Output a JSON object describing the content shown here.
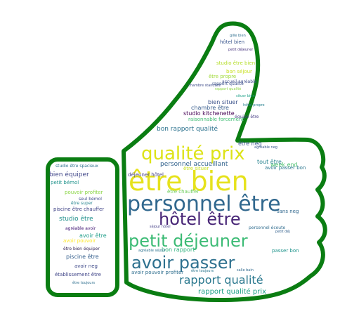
{
  "wordcloud": {
    "outline_color": "#0a7d12",
    "words": [
      {
        "id": "w-etre-bien",
        "text": "être bien",
        "color": "#e6e21c"
      },
      {
        "id": "w-personnel-etre",
        "text": "personnel être",
        "color": "#31688e"
      },
      {
        "id": "w-qualite-prix",
        "text": "qualité prix",
        "color": "#dde318"
      },
      {
        "id": "w-hotel-etre",
        "text": "hôtel être",
        "color": "#482677"
      },
      {
        "id": "w-petit-dejeuner",
        "text": "petit déjeuner",
        "color": "#3cbb75"
      },
      {
        "id": "w-avoir-passer",
        "text": "avoir passer",
        "color": "#2d708e"
      },
      {
        "id": "w-rapport-qualite",
        "text": "rapport qualité",
        "color": "#2a788e"
      },
      {
        "id": "w-rapport-qualite-prix",
        "text": "rapport qualité prix",
        "color": "#1fa187"
      },
      {
        "id": "w-personnel-accueillant",
        "text": "personnel accueillant",
        "color": "#33638d"
      },
      {
        "id": "w-bon-rapport-qualite",
        "text": "bon rapport qualité",
        "color": "#2c728e"
      },
      {
        "id": "w-studio-kitchenette",
        "text": "studio kitchenette",
        "color": "#440154"
      },
      {
        "id": "w-chambre-etre",
        "text": "chambre être",
        "color": "#365c8d"
      },
      {
        "id": "w-bien-situer",
        "text": "bien situer",
        "color": "#3b528b"
      },
      {
        "id": "w-hotel-bien",
        "text": "hôtel bien",
        "color": "#39558c"
      },
      {
        "id": "w-studio-etre-bien",
        "text": "studio être bien",
        "color": "#b5de2b"
      },
      {
        "id": "w-etre-propre",
        "text": "être propre",
        "color": "#a0da39"
      },
      {
        "id": "w-bon-sejour",
        "text": "bon séjour",
        "color": "#c8e020"
      },
      {
        "id": "w-raisonnable-forcement",
        "text": "raisonnable forcement",
        "color": "#3fbc73"
      },
      {
        "id": "w-week-end",
        "text": "week end",
        "color": "#4ac16d"
      },
      {
        "id": "w-tout-etre",
        "text": "tout être",
        "color": "#26828e"
      },
      {
        "id": "w-avoir-passer-bon",
        "text": "avoir passer bon",
        "color": "#2a768e"
      },
      {
        "id": "w-etre-neg",
        "text": "être neg",
        "color": "#3a548c"
      },
      {
        "id": "w-sans-neg",
        "text": "sans neg",
        "color": "#31688e"
      },
      {
        "id": "w-personnel-ecoute",
        "text": "personnel écoute",
        "color": "#2f6c8e"
      },
      {
        "id": "w-passer-bon",
        "text": "passer bon",
        "color": "#1f948c"
      },
      {
        "id": "w-bon-rapport",
        "text": "bon rapport",
        "color": "#2db27d"
      },
      {
        "id": "w-avoir-pouvoir-profiter",
        "text": "avoir pouvoir profiter",
        "color": "#2e6e8e"
      },
      {
        "id": "w-etre-chauffer",
        "text": "être chauffer",
        "color": "#6ccd5a"
      },
      {
        "id": "w-dejeuner-hotel",
        "text": "déjeuner hôtel",
        "color": "#433e85"
      },
      {
        "id": "w-etre-situer",
        "text": "être situer",
        "color": "#cae11f"
      },
      {
        "id": "w-studio-etre-spacieux",
        "text": "studio être spacieux",
        "color": "#2c728e"
      },
      {
        "id": "w-bien-equiper",
        "text": "bien équiper",
        "color": "#404688"
      },
      {
        "id": "w-petit-bemol",
        "text": "petit bémol",
        "color": "#20938c"
      },
      {
        "id": "w-pouvoir-profiter",
        "text": "pouvoir profiter",
        "color": "#8bd646"
      },
      {
        "id": "w-seul-bemol",
        "text": "seul bémol",
        "color": "#3e4a89"
      },
      {
        "id": "w-piscine-etre-chauffer",
        "text": "piscine être chauffer",
        "color": "#414487"
      },
      {
        "id": "w-studio-etre",
        "text": "studio être",
        "color": "#21918c"
      },
      {
        "id": "w-agreable-avoir",
        "text": "agréable avoir",
        "color": "#3b0f70"
      },
      {
        "id": "w-avoir-etre",
        "text": "avoir être",
        "color": "#1f9e89"
      },
      {
        "id": "w-avoir-pouvoir",
        "text": "avoir pouvoir",
        "color": "#fde725"
      },
      {
        "id": "w-etre-bien-equiper",
        "text": "être bien équiper",
        "color": "#2d1e50"
      },
      {
        "id": "w-piscine-etre",
        "text": "piscine être",
        "color": "#355f8d"
      },
      {
        "id": "w-avoir-neg",
        "text": "avoir neg",
        "color": "#3e4989"
      },
      {
        "id": "w-etablissement-etre",
        "text": "établissement être",
        "color": "#404588"
      },
      {
        "id": "w-etre-toujours",
        "text": "être toujours",
        "color": "#2e6f8e"
      },
      {
        "id": "w-etre-super",
        "text": "être super",
        "color": "#25848e"
      },
      {
        "id": "w-rapport-qualite-small",
        "text": "rapport qualité",
        "color": "#3b528b"
      },
      {
        "id": "w-equipe-etre",
        "text": "équipe être",
        "color": "#443a83"
      },
      {
        "id": "w-accueil-agreable",
        "text": "accueil agréable",
        "color": "#3d4d8a"
      },
      {
        "id": "w-agreable-sejour",
        "text": "agréable séjour",
        "color": "#2c728e"
      },
      {
        "id": "w-sejour-hotel",
        "text": "séjour hôtel",
        "color": "#433e85"
      },
      {
        "id": "w-rapport-qualite-2",
        "text": "rapport qualité",
        "color": "#8fd744"
      },
      {
        "id": "w-salle-bain",
        "text": "salle bain",
        "color": "#30698e"
      },
      {
        "id": "w-gille-bien",
        "text": "gille bien",
        "color": "#2e6e8e"
      },
      {
        "id": "w-petit-dejeuner-small",
        "text": "petit déjeuner",
        "color": "#46337e"
      },
      {
        "id": "w-chambre-standard",
        "text": "chambre standard",
        "color": "#3e4c8a"
      },
      {
        "id": "w-situer-bien",
        "text": "situer bien",
        "color": "#1fa088"
      },
      {
        "id": "w-hotel-propre",
        "text": "hôtel propre",
        "color": "#27808e"
      },
      {
        "id": "w-agreable-neg",
        "text": "agréable neg",
        "color": "#38588c"
      },
      {
        "id": "w-etre-toujours-2",
        "text": "être toujours",
        "color": "#2a778e"
      },
      {
        "id": "w-petit-dej",
        "text": "petit déj",
        "color": "#34618d"
      }
    ]
  }
}
